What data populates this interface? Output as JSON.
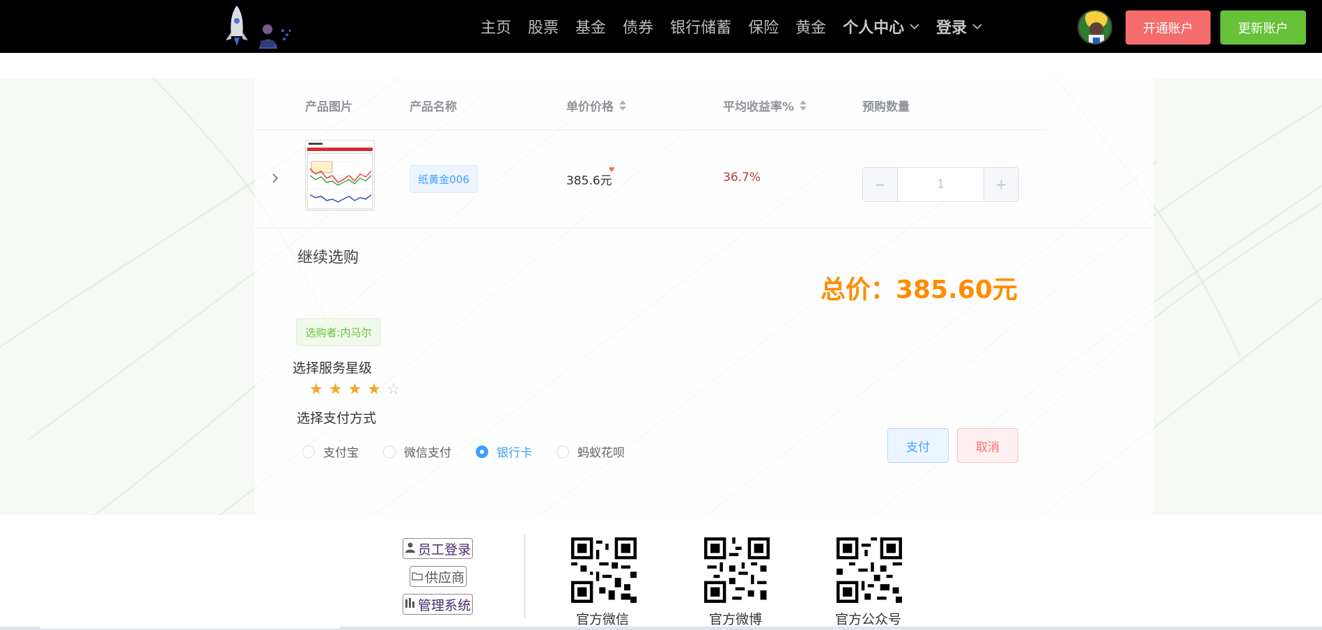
{
  "header": {
    "nav": [
      {
        "label": "主页"
      },
      {
        "label": "股票"
      },
      {
        "label": "基金"
      },
      {
        "label": "债券"
      },
      {
        "label": "银行储蓄"
      },
      {
        "label": "保险"
      },
      {
        "label": "黄金"
      }
    ],
    "dropdowns": [
      {
        "label": "个人中心"
      },
      {
        "label": "登录"
      }
    ],
    "open_account_label": "开通账户",
    "update_account_label": "更新账户"
  },
  "table": {
    "headers": {
      "image": "产品图片",
      "name": "产品名称",
      "price": "单价价格",
      "yield": "平均收益率%",
      "quantity": "预购数量"
    },
    "row": {
      "name": "纸黄金006",
      "price": "385.6元",
      "yield": "36.7%",
      "quantity": "1",
      "minus": "−",
      "plus": "+"
    }
  },
  "order": {
    "continue_label": "继续选购",
    "total": "总价：385.60元",
    "buyer": "选购者:内马尔",
    "star_label": "选择服务星级",
    "rating": 4,
    "rating_max": 5,
    "pay_label": "选择支付方式",
    "payment_options": [
      {
        "label": "支付宝",
        "checked": false
      },
      {
        "label": "微信支付",
        "checked": false
      },
      {
        "label": "银行卡",
        "checked": true
      },
      {
        "label": "蚂蚁花呗",
        "checked": false
      }
    ],
    "pay_button": "支付",
    "cancel_button": "取消"
  },
  "footer": {
    "links": [
      {
        "label": "员工登录",
        "icon": "user-icon"
      },
      {
        "label": "供应商",
        "icon": "folder-icon"
      },
      {
        "label": "管理系统",
        "icon": "chart-icon"
      }
    ],
    "qr_labels": [
      "官方微信",
      "官方微博",
      "官方公众号"
    ]
  },
  "colors": {
    "header_bg": "#000000",
    "open_account": "#f56c6c",
    "update_account": "#67c23a",
    "total": "#ff8c00",
    "primary": "#409eff"
  }
}
